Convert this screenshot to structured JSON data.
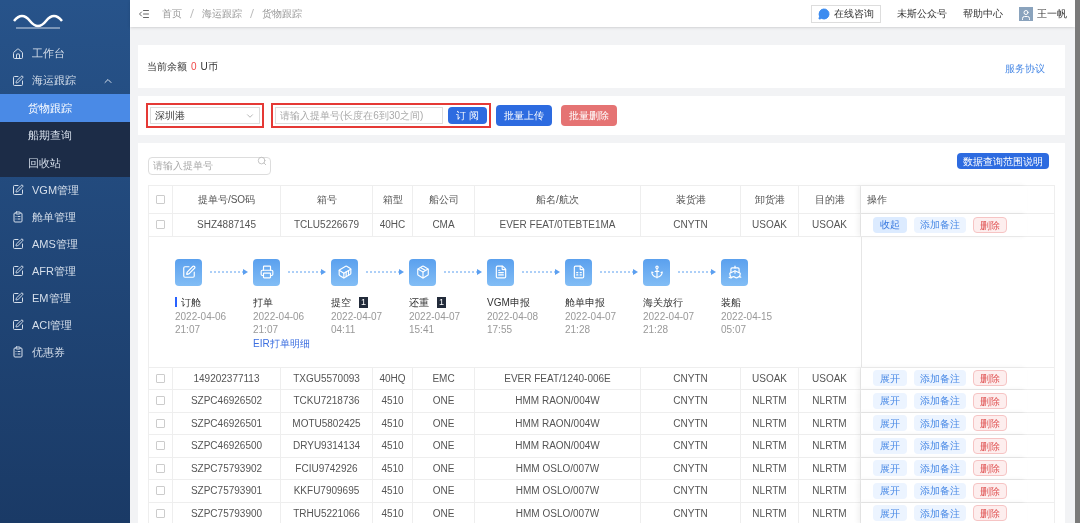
{
  "sidebar": {
    "items": [
      {
        "label": "工作台",
        "kind": "home"
      },
      {
        "label": "海运跟踪",
        "kind": "doc",
        "expanded": true,
        "children": [
          {
            "label": "货物跟踪",
            "selected": true
          },
          {
            "label": "船期查询",
            "selected": false
          },
          {
            "label": "回收站",
            "selected": false
          }
        ]
      },
      {
        "label": "VGM管理",
        "kind": "doc"
      },
      {
        "label": "舱单管理",
        "kind": "clipboard"
      },
      {
        "label": "AMS管理",
        "kind": "doc"
      },
      {
        "label": "AFR管理",
        "kind": "doc"
      },
      {
        "label": "EM管理",
        "kind": "doc"
      },
      {
        "label": "ACI管理",
        "kind": "doc"
      },
      {
        "label": "优惠券",
        "kind": "clipboard"
      }
    ]
  },
  "topbar": {
    "breadcrumb": [
      "首页",
      "海运跟踪",
      "货物跟踪"
    ],
    "consult_button": "在线咨询",
    "links": [
      "未斯公众号",
      "帮助中心"
    ],
    "user_name": "王一帆"
  },
  "balance": {
    "label": "当前余额",
    "value": "0",
    "unit": "U币",
    "agreement_link": "服务协议"
  },
  "subscribe": {
    "port": "深圳港",
    "port_highlighted": true,
    "placeholder": "请输入提单号(长度在6到30之间)",
    "input_highlighted": true,
    "subscribe_button": "订 阅",
    "upload_button": "批量上传",
    "delete_button": "批量删除"
  },
  "table": {
    "search_placeholder": "请输入提单号",
    "range_button": "数据查询范围说明",
    "all_checked": false,
    "columns": [
      "提单号/SO码",
      "箱号",
      "箱型",
      "船公司",
      "船名/航次",
      "装货港",
      "卸货港",
      "目的港",
      "操作"
    ],
    "rows": [
      {
        "checked": false,
        "cells": [
          "SHZ4887145",
          "TCLU5226679",
          "40HC",
          "CMA",
          "EVER FEAT/0TEBTE1MA",
          "CNYTN",
          "USOAK",
          "USOAK"
        ],
        "toggle": "收起",
        "expanded": true,
        "remark": "添加备注",
        "delete": "删除",
        "steps": [
          {
            "kind": "edit",
            "label": "订舱",
            "current": true,
            "date": "2022-04-06",
            "time": "21:07"
          },
          {
            "kind": "print",
            "label": "打单",
            "current": false,
            "date": "2022-04-06",
            "time": "21:07",
            "link": "EIR打单明细"
          },
          {
            "kind": "container",
            "label": "提空",
            "current": false,
            "badge": "1",
            "date": "2022-04-07",
            "time": "04:11"
          },
          {
            "kind": "box",
            "label": "还重",
            "current": false,
            "badge": "1",
            "date": "2022-04-07",
            "time": "15:41"
          },
          {
            "kind": "file",
            "label": "VGM申报",
            "current": false,
            "date": "2022-04-08",
            "time": "17:55"
          },
          {
            "kind": "list",
            "label": "舱单申报",
            "current": false,
            "date": "2022-04-07",
            "time": "21:28"
          },
          {
            "kind": "anchor",
            "label": "海关放行",
            "current": false,
            "date": "2022-04-07",
            "time": "21:28"
          },
          {
            "kind": "ship",
            "label": "装船",
            "current": false,
            "date": "2022-04-15",
            "time": "05:07"
          }
        ]
      },
      {
        "checked": false,
        "cells": [
          "149202377113",
          "TXGU5570093",
          "40HQ",
          "EMC",
          "EVER FEAT/1240-006E",
          "CNYTN",
          "USOAK",
          "USOAK"
        ],
        "toggle": "展开",
        "expanded": false,
        "remark": "添加备注",
        "delete": "删除"
      },
      {
        "checked": false,
        "cells": [
          "SZPC46926502",
          "TCKU7218736",
          "4510",
          "ONE",
          "HMM RAON/004W",
          "CNYTN",
          "NLRTM",
          "NLRTM"
        ],
        "toggle": "展开",
        "expanded": false,
        "remark": "添加备注",
        "delete": "删除"
      },
      {
        "checked": false,
        "cells": [
          "SZPC46926501",
          "MOTU5802425",
          "4510",
          "ONE",
          "HMM RAON/004W",
          "CNYTN",
          "NLRTM",
          "NLRTM"
        ],
        "toggle": "展开",
        "expanded": false,
        "remark": "添加备注",
        "delete": "删除"
      },
      {
        "checked": false,
        "cells": [
          "SZPC46926500",
          "DRYU9314134",
          "4510",
          "ONE",
          "HMM RAON/004W",
          "CNYTN",
          "NLRTM",
          "NLRTM"
        ],
        "toggle": "展开",
        "expanded": false,
        "remark": "添加备注",
        "delete": "删除"
      },
      {
        "checked": false,
        "cells": [
          "SZPC75793902",
          "FCIU9742926",
          "4510",
          "ONE",
          "HMM OSLO/007W",
          "CNYTN",
          "NLRTM",
          "NLRTM"
        ],
        "toggle": "展开",
        "expanded": false,
        "remark": "添加备注",
        "delete": "删除"
      },
      {
        "checked": false,
        "cells": [
          "SZPC75793901",
          "KKFU7909695",
          "4510",
          "ONE",
          "HMM OSLO/007W",
          "CNYTN",
          "NLRTM",
          "NLRTM"
        ],
        "toggle": "展开",
        "expanded": false,
        "remark": "添加备注",
        "delete": "删除"
      },
      {
        "checked": false,
        "cells": [
          "SZPC75793900",
          "TRHU5221066",
          "4510",
          "ONE",
          "HMM OSLO/007W",
          "CNYTN",
          "NLRTM",
          "NLRTM"
        ],
        "toggle": "展开",
        "expanded": false,
        "remark": "添加备注",
        "delete": "删除"
      }
    ]
  }
}
